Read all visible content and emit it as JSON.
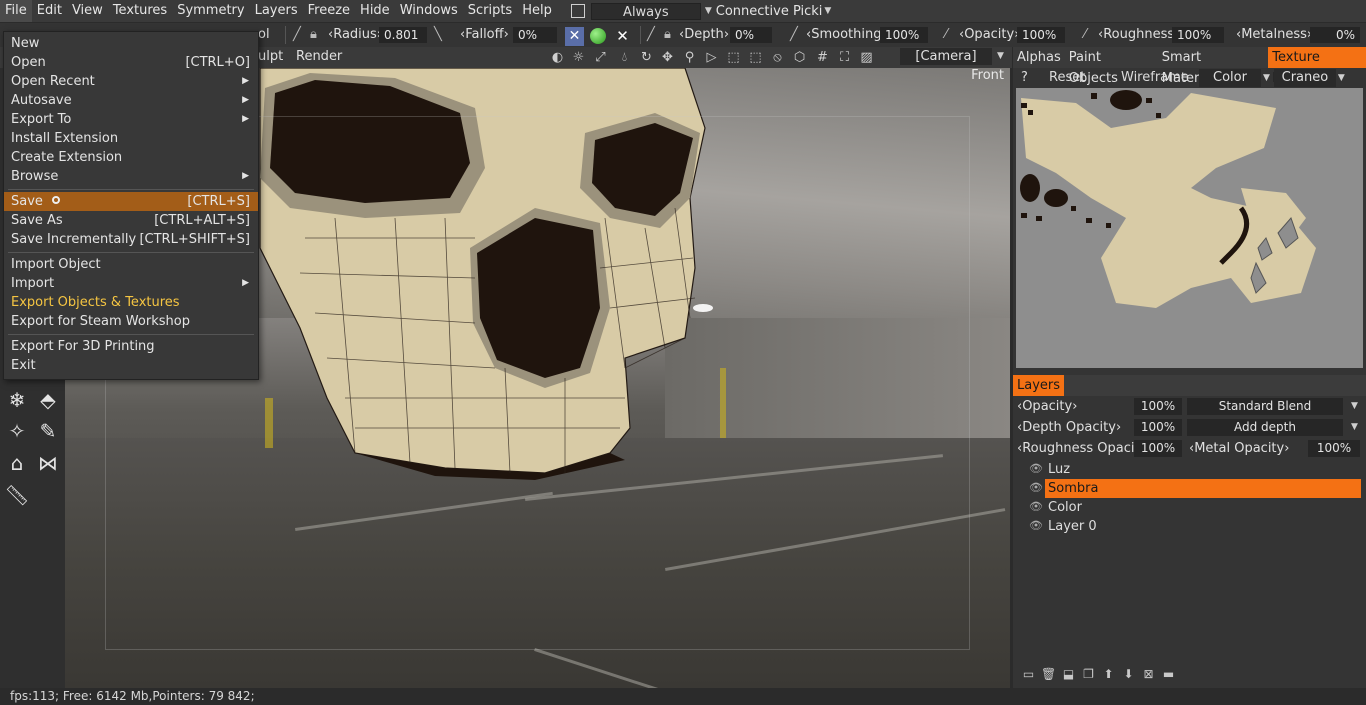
{
  "menubar": {
    "items": [
      "File",
      "Edit",
      "View",
      "Textures",
      "Symmetry",
      "Layers",
      "Freeze",
      "Hide",
      "Windows",
      "Scripts",
      "Help"
    ],
    "always_label": "Always",
    "picking_label": "Connective Picki"
  },
  "toolbar1": {
    "tool_partial": "ol",
    "radius_label": "Radius",
    "radius_value": "0.801",
    "falloff_label": "Falloff",
    "falloff_value": "0%",
    "depth_label": "Depth",
    "depth_value": "0%",
    "smoothing_label": "Smoothing",
    "smoothing_value": "100%",
    "opacity_label": "Opacity",
    "opacity_value": "100%",
    "roughness_label": "Roughness",
    "roughness_value": "100%",
    "metalness_label": "Metalness",
    "metalness_value": "0%"
  },
  "toolbar2": {
    "sculpt_partial": "ulpt",
    "render_label": "Render",
    "camera_label": "[Camera]"
  },
  "viewport": {
    "view_label": "Front"
  },
  "file_menu": {
    "items": [
      {
        "label": "New",
        "shortcut": ""
      },
      {
        "label": "Open",
        "shortcut": "[CTRL+O]"
      },
      {
        "label": "Open Recent",
        "shortcut": ""
      },
      {
        "label": "Autosave",
        "shortcut": ""
      },
      {
        "label": "Export To",
        "shortcut": ""
      },
      {
        "label": "Install Extension",
        "shortcut": ""
      },
      {
        "label": "Create Extension",
        "shortcut": ""
      },
      {
        "label": "Browse",
        "shortcut": ""
      },
      {
        "label": "Save",
        "shortcut": "[CTRL+S]"
      },
      {
        "label": "Save As",
        "shortcut": "[CTRL+ALT+S]"
      },
      {
        "label": "Save Incrementally",
        "shortcut": "[CTRL+SHIFT+S]"
      },
      {
        "label": "Import Object",
        "shortcut": ""
      },
      {
        "label": "Import",
        "shortcut": ""
      },
      {
        "label": "Export Objects & Textures",
        "shortcut": ""
      },
      {
        "label": "Export for Steam Workshop",
        "shortcut": ""
      },
      {
        "label": "Export For 3D Printing",
        "shortcut": ""
      },
      {
        "label": "Exit",
        "shortcut": ""
      }
    ]
  },
  "right_panel": {
    "tabs": [
      "Alphas",
      "Paint Objects",
      "Smart Materials",
      "Texture Editor"
    ],
    "active_tab": "Texture Editor",
    "help_label": "?",
    "reset_label": "Reset",
    "wireframe_label": "Wireframe",
    "channel_label": "Color",
    "object_label": "Craneo"
  },
  "layers": {
    "title": "Layers",
    "opacity_label": "Opacity",
    "opacity_value": "100%",
    "blend_mode": "Standard Blend",
    "depth_opacity_label": "Depth Opacity",
    "depth_opacity_value": "100%",
    "depth_mode": "Add depth",
    "roughness_opacity_label": "Roughness Opacit",
    "roughness_opacity_value": "100%",
    "metal_opacity_label": "Metal Opacity",
    "metal_opacity_value": "100%",
    "items": [
      {
        "name": "Luz",
        "selected": false
      },
      {
        "name": "Sombra",
        "selected": true
      },
      {
        "name": "Color",
        "selected": false
      },
      {
        "name": "Layer 0",
        "selected": false
      }
    ]
  },
  "status": {
    "text": "fps:113;   Free: 6142 Mb,Pointers: 79  842;"
  },
  "colors": {
    "accent": "#f47114",
    "menu_highlight": "#a35d18",
    "gold_text": "#f5c542",
    "bone": "#d8cba6",
    "socket": "#1f140d"
  }
}
